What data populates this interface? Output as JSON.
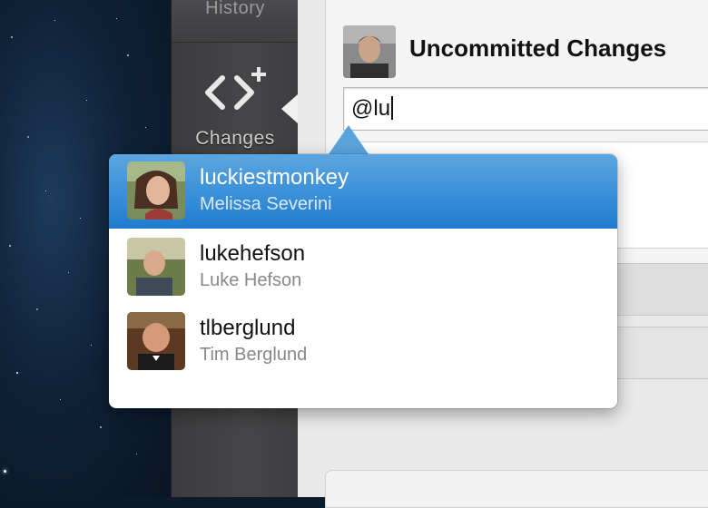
{
  "sidebar": {
    "history_label": "History",
    "changes_label": "Changes"
  },
  "commit": {
    "title": "Uncommitted Changes",
    "summary_value": "@lu"
  },
  "autocomplete": {
    "items": [
      {
        "username": "luckiestmonkey",
        "full_name": "Melissa Severini",
        "selected": true
      },
      {
        "username": "lukehefson",
        "full_name": "Luke Hefson",
        "selected": false
      },
      {
        "username": "tlberglund",
        "full_name": "Tim Berglund",
        "selected": false
      }
    ]
  },
  "colors": {
    "selection_top": "#5ba6e0",
    "selection_bottom": "#1f7cd0",
    "sidebar": "#434345"
  },
  "icons": {
    "changes": "code-brackets-plus-icon"
  }
}
